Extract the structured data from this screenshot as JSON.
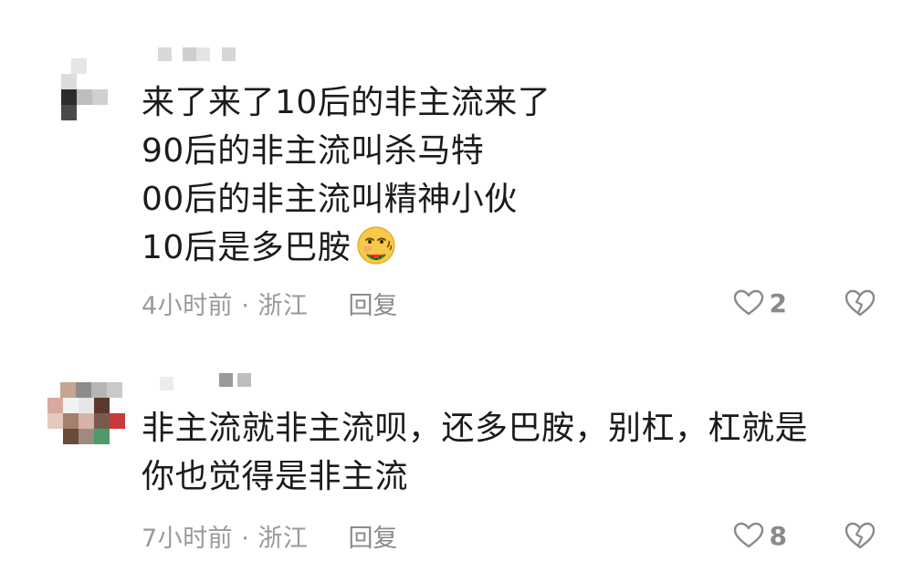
{
  "comments": [
    {
      "lines": [
        "来了来了10后的非主流来了",
        "90后的非主流叫杀马特",
        "00后的非主流叫精神小伙",
        "10后是多巴胺"
      ],
      "emoji": "face-with-watermelon-emoji",
      "time": "4小时前 · 浙江",
      "reply_label": "回复",
      "like_count": "2"
    },
    {
      "lines": [
        "非主流就非主流呗，还多巴胺，别杠，杠就是",
        "你也觉得是非主流"
      ],
      "time": "7小时前 · 浙江",
      "reply_label": "回复",
      "like_count": "8"
    }
  ],
  "icons": {
    "like": "heart-outline-icon",
    "dislike": "broken-heart-outline-icon"
  },
  "colors": {
    "text": "#1b1b1b",
    "meta": "#9a9a9a",
    "icon": "#8a8a8a"
  }
}
